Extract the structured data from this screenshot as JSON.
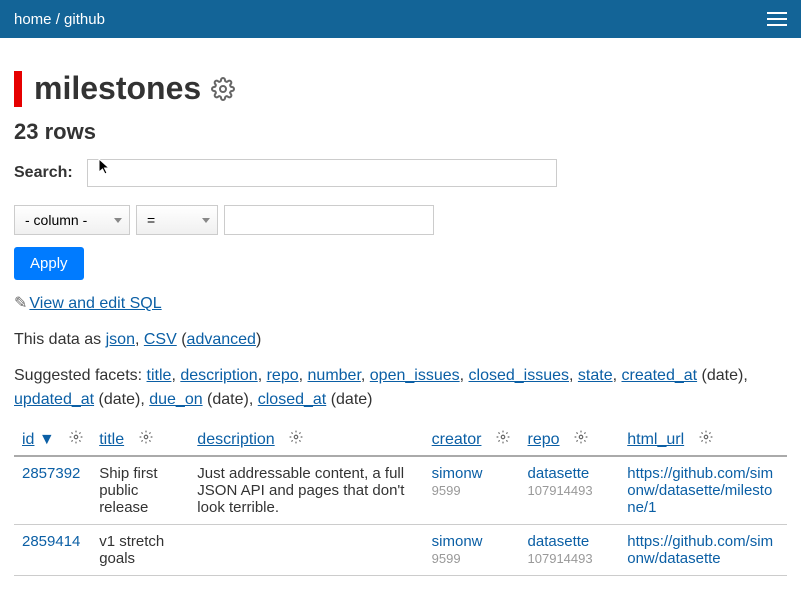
{
  "breadcrumb": {
    "home": "home",
    "sep": " / ",
    "db": "github"
  },
  "page": {
    "title": "milestones",
    "rowcount": "23 rows"
  },
  "search": {
    "label": "Search:",
    "value": ""
  },
  "filter": {
    "column_placeholder": "- column -",
    "op": "=",
    "value": "",
    "apply": "Apply"
  },
  "sql_link": "View and edit SQL",
  "export": {
    "prefix": "This data as ",
    "json": "json",
    "csv": "CSV",
    "adv": "advanced"
  },
  "facets": {
    "prefix": "Suggested facets: ",
    "items": [
      "title",
      "description",
      "repo",
      "number",
      "open_issues",
      "closed_issues",
      "state",
      "created_at"
    ],
    "date_suffix": " (date)",
    "line2": {
      "updated_at": "updated_at",
      "due_on": "due_on",
      "closed_at": "closed_at"
    }
  },
  "columns": {
    "id": "id",
    "sort_ind": " ▼",
    "title": "title",
    "description": "description",
    "creator": "creator",
    "repo": "repo",
    "html_url": "html_url"
  },
  "rows": [
    {
      "id": "2857392",
      "title": "Ship first public release",
      "description": "Just addressable content, a full JSON API and pages that don't look terrible.",
      "creator": "simonw",
      "creator_id": "9599",
      "repo": "datasette",
      "repo_id": "107914493",
      "html_url": "https://github.com/simonw/datasette/milestone/1"
    },
    {
      "id": "2859414",
      "title": "v1 stretch goals",
      "description": "",
      "creator": "simonw",
      "creator_id": "9599",
      "repo": "datasette",
      "repo_id": "107914493",
      "html_url": "https://github.com/simonw/datasette"
    }
  ]
}
